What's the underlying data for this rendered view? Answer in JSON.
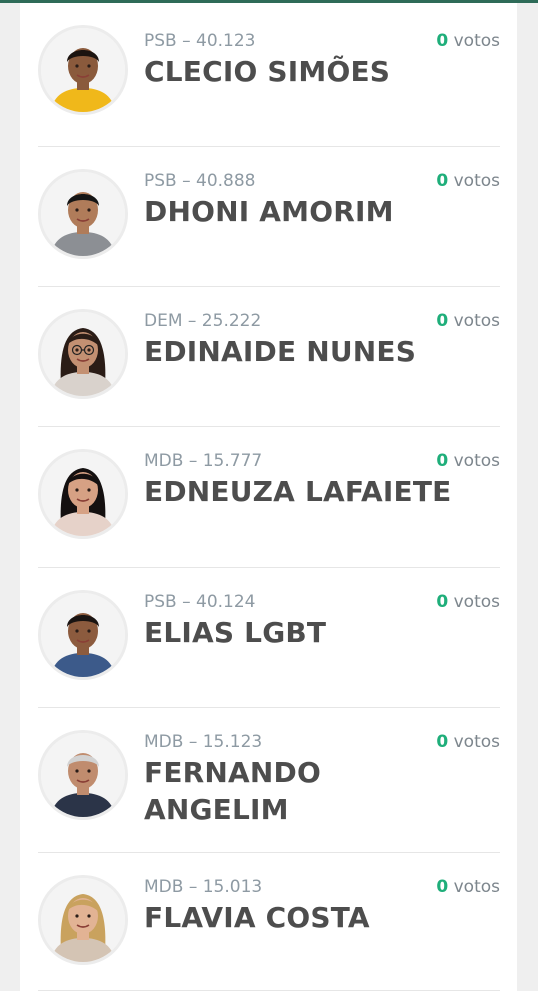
{
  "votes_word": "votos",
  "candidates": [
    {
      "party_number": "PSB – 40.123",
      "name": "CLECIO SIMÕES",
      "votes": "0",
      "avatar_icon": "candidate-photo-man-yellow-shirt",
      "skin": "#8a5a3c",
      "hair": "#1c1410",
      "shirt": "#f0b81a"
    },
    {
      "party_number": "PSB – 40.888",
      "name": "DHONI AMORIM",
      "votes": "0",
      "avatar_icon": "candidate-photo-man-grey-shirt",
      "skin": "#b07c5a",
      "hair": "#151515",
      "shirt": "#8c8f94"
    },
    {
      "party_number": "DEM – 25.222",
      "name": "EDINAIDE NUNES",
      "votes": "0",
      "avatar_icon": "candidate-photo-woman-glasses",
      "skin": "#c39072",
      "hair": "#2a1c16",
      "shirt": "#d9d2cc"
    },
    {
      "party_number": "MDB – 15.777",
      "name": "EDNEUZA LAFAIETE",
      "votes": "0",
      "avatar_icon": "candidate-photo-woman-dark-hair",
      "skin": "#d6a184",
      "hair": "#141010",
      "shirt": "#e6d2c9"
    },
    {
      "party_number": "PSB – 40.124",
      "name": "ELIAS LGBT",
      "votes": "0",
      "avatar_icon": "candidate-photo-man-blue-shirt",
      "skin": "#8c5b3e",
      "hair": "#1a1412",
      "shirt": "#3c5a8a"
    },
    {
      "party_number": "MDB – 15.123",
      "name": "FERNANDO ANGELIM",
      "votes": "0",
      "avatar_icon": "candidate-photo-man-grey-hair",
      "skin": "#c08c6e",
      "hair": "#d2d2d2",
      "shirt": "#2b3448"
    },
    {
      "party_number": "MDB – 15.013",
      "name": "FLAVIA COSTA",
      "votes": "0",
      "avatar_icon": "candidate-photo-woman-blonde",
      "skin": "#e2b394",
      "hair": "#c9a25e",
      "shirt": "#d4c4b4"
    }
  ]
}
